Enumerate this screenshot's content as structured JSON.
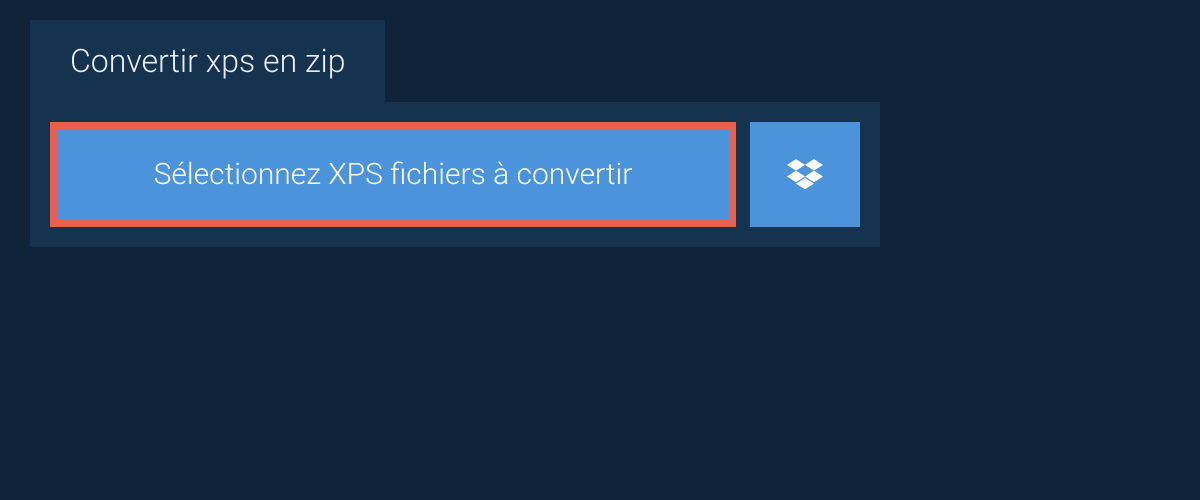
{
  "tab": {
    "title": "Convertir xps en zip"
  },
  "panel": {
    "select_label": "Sélectionnez XPS fichiers à convertir",
    "dropbox_icon": "dropbox"
  }
}
